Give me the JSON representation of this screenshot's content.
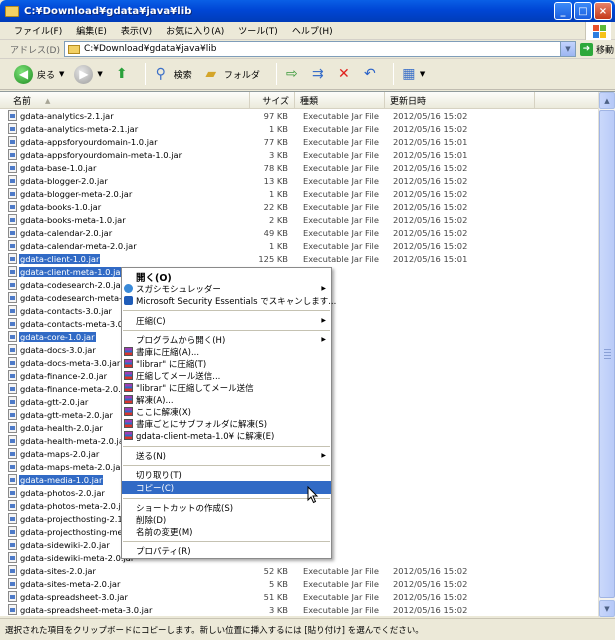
{
  "window": {
    "title": "C:¥Download¥gdata¥java¥lib",
    "minimize": "_",
    "maximize": "□",
    "close": "×"
  },
  "menubar": {
    "items": [
      "ファイル(F)",
      "編集(E)",
      "表示(V)",
      "お気に入り(A)",
      "ツール(T)",
      "ヘルプ(H)"
    ]
  },
  "address": {
    "label": "アドレス(D)",
    "value": "C:¥Download¥gdata¥java¥lib",
    "go_label": "移動"
  },
  "toolbar": {
    "back_label": "戻る",
    "search_label": "検索",
    "folders_label": "フォルダ"
  },
  "columns": {
    "name": "名前",
    "size": "サイズ",
    "type": "種類",
    "date": "更新日時"
  },
  "files": [
    {
      "name": "gdata-analytics-2.1.jar",
      "size": "97 KB",
      "type": "Executable Jar File",
      "date": "2012/05/16 15:02",
      "selected": false
    },
    {
      "name": "gdata-analytics-meta-2.1.jar",
      "size": "1 KB",
      "type": "Executable Jar File",
      "date": "2012/05/16 15:02",
      "selected": false
    },
    {
      "name": "gdata-appsforyourdomain-1.0.jar",
      "size": "77 KB",
      "type": "Executable Jar File",
      "date": "2012/05/16 15:01",
      "selected": false
    },
    {
      "name": "gdata-appsforyourdomain-meta-1.0.jar",
      "size": "3 KB",
      "type": "Executable Jar File",
      "date": "2012/05/16 15:01",
      "selected": false
    },
    {
      "name": "gdata-base-1.0.jar",
      "size": "78 KB",
      "type": "Executable Jar File",
      "date": "2012/05/16 15:02",
      "selected": false
    },
    {
      "name": "gdata-blogger-2.0.jar",
      "size": "13 KB",
      "type": "Executable Jar File",
      "date": "2012/05/16 15:02",
      "selected": false
    },
    {
      "name": "gdata-blogger-meta-2.0.jar",
      "size": "1 KB",
      "type": "Executable Jar File",
      "date": "2012/05/16 15:02",
      "selected": false
    },
    {
      "name": "gdata-books-1.0.jar",
      "size": "22 KB",
      "type": "Executable Jar File",
      "date": "2012/05/16 15:02",
      "selected": false
    },
    {
      "name": "gdata-books-meta-1.0.jar",
      "size": "2 KB",
      "type": "Executable Jar File",
      "date": "2012/05/16 15:02",
      "selected": false
    },
    {
      "name": "gdata-calendar-2.0.jar",
      "size": "49 KB",
      "type": "Executable Jar File",
      "date": "2012/05/16 15:02",
      "selected": false
    },
    {
      "name": "gdata-calendar-meta-2.0.jar",
      "size": "1 KB",
      "type": "Executable Jar File",
      "date": "2012/05/16 15:02",
      "selected": false
    },
    {
      "name": "gdata-client-1.0.jar",
      "size": "125 KB",
      "type": "Executable Jar File",
      "date": "2012/05/16 15:01",
      "selected": true
    },
    {
      "name": "gdata-client-meta-1.0.jar",
      "size": "",
      "type": "",
      "date": "",
      "selected": true
    },
    {
      "name": "gdata-codesearch-2.0.jar",
      "size": "",
      "type": "",
      "date": "",
      "selected": false
    },
    {
      "name": "gdata-codesearch-meta-2.0.jar",
      "size": "",
      "type": "",
      "date": "",
      "selected": false
    },
    {
      "name": "gdata-contacts-3.0.jar",
      "size": "",
      "type": "",
      "date": "",
      "selected": false
    },
    {
      "name": "gdata-contacts-meta-3.0.jar",
      "size": "",
      "type": "",
      "date": "",
      "selected": false
    },
    {
      "name": "gdata-core-1.0.jar",
      "size": "",
      "type": "",
      "date": "",
      "selected": true
    },
    {
      "name": "gdata-docs-3.0.jar",
      "size": "",
      "type": "",
      "date": "",
      "selected": false
    },
    {
      "name": "gdata-docs-meta-3.0.jar",
      "size": "",
      "type": "",
      "date": "",
      "selected": false
    },
    {
      "name": "gdata-finance-2.0.jar",
      "size": "",
      "type": "",
      "date": "",
      "selected": false
    },
    {
      "name": "gdata-finance-meta-2.0.jar",
      "size": "",
      "type": "",
      "date": "",
      "selected": false
    },
    {
      "name": "gdata-gtt-2.0.jar",
      "size": "",
      "type": "",
      "date": "",
      "selected": false
    },
    {
      "name": "gdata-gtt-meta-2.0.jar",
      "size": "",
      "type": "",
      "date": "",
      "selected": false
    },
    {
      "name": "gdata-health-2.0.jar",
      "size": "",
      "type": "",
      "date": "",
      "selected": false
    },
    {
      "name": "gdata-health-meta-2.0.jar",
      "size": "",
      "type": "",
      "date": "",
      "selected": false
    },
    {
      "name": "gdata-maps-2.0.jar",
      "size": "",
      "type": "",
      "date": "",
      "selected": false
    },
    {
      "name": "gdata-maps-meta-2.0.jar",
      "size": "",
      "type": "",
      "date": "",
      "selected": false
    },
    {
      "name": "gdata-media-1.0.jar",
      "size": "",
      "type": "",
      "date": "",
      "selected": true
    },
    {
      "name": "gdata-photos-2.0.jar",
      "size": "",
      "type": "",
      "date": "",
      "selected": false
    },
    {
      "name": "gdata-photos-meta-2.0.jar",
      "size": "",
      "type": "",
      "date": "",
      "selected": false
    },
    {
      "name": "gdata-projecthosting-2.1.jar",
      "size": "",
      "type": "",
      "date": "",
      "selected": false
    },
    {
      "name": "gdata-projecthosting-meta-2.1.jar",
      "size": "",
      "type": "",
      "date": "",
      "selected": false
    },
    {
      "name": "gdata-sidewiki-2.0.jar",
      "size": "",
      "type": "",
      "date": "",
      "selected": false
    },
    {
      "name": "gdata-sidewiki-meta-2.0.jar",
      "size": "",
      "type": "",
      "date": "",
      "selected": false
    },
    {
      "name": "gdata-sites-2.0.jar",
      "size": "52 KB",
      "type": "Executable Jar File",
      "date": "2012/05/16 15:02",
      "selected": false
    },
    {
      "name": "gdata-sites-meta-2.0.jar",
      "size": "5 KB",
      "type": "Executable Jar File",
      "date": "2012/05/16 15:02",
      "selected": false
    },
    {
      "name": "gdata-spreadsheet-3.0.jar",
      "size": "51 KB",
      "type": "Executable Jar File",
      "date": "2012/05/16 15:02",
      "selected": false
    },
    {
      "name": "gdata-spreadsheet-meta-3.0.jar",
      "size": "3 KB",
      "type": "Executable Jar File",
      "date": "2012/05/16 15:02",
      "selected": false
    }
  ],
  "context_menu": {
    "open": "開く(O)",
    "sugarsync": "スガシモシュレッダー",
    "mse_scan": "Microsoft Security Essentials でスキャンします...",
    "compress": "圧縮(C)",
    "open_with": "プログラムから開く(H)",
    "add_archive": "書庫に圧縮(A)...",
    "add_rar": "\"librar\" に圧縮(T)",
    "compress_mail": "圧縮してメール送信...",
    "compress_rar_mail": "\"librar\" に圧縮してメール送信",
    "extract": "解凍(A)...",
    "extract_here": "ここに解凍(X)",
    "extract_each": "書庫ごとにサブフォルダに解凍(S)",
    "extract_to": "gdata-client-meta-1.0¥ に解凍(E)",
    "send_to": "送る(N)",
    "cut": "切り取り(T)",
    "copy": "コピー(C)",
    "create_shortcut": "ショートカットの作成(S)",
    "delete": "削除(D)",
    "rename": "名前の変更(M)",
    "properties": "プロパティ(R)"
  },
  "status": {
    "text": "選択された項目をクリップボードにコピーします。新しい位置に挿入するには [貼り付け] を選んでください。"
  }
}
